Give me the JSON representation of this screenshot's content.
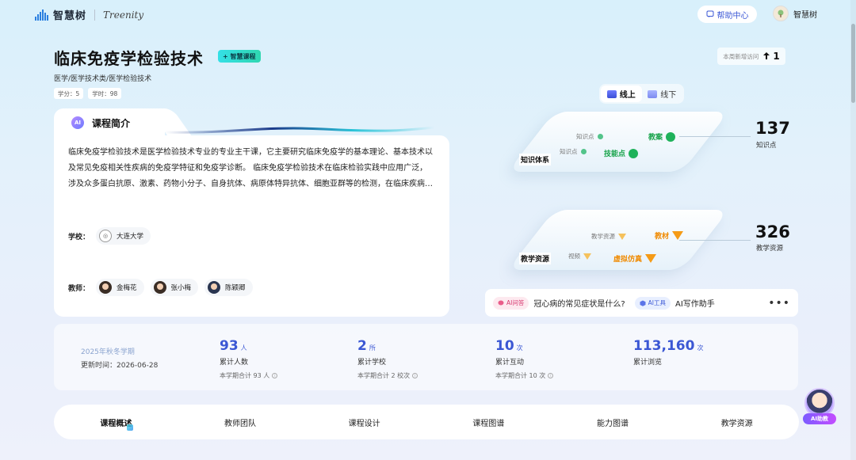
{
  "header": {
    "logo_text": "智慧树",
    "logo_secondary": "Treenity",
    "help_label": "帮助中心",
    "user_name": "智慧树"
  },
  "course": {
    "title": "临床免疫学检验技术",
    "badge": "+ 智慧课程",
    "breadcrumb": "医学/医学技术类/医学检验技术",
    "credits": "学分：5",
    "hours": "学时：98",
    "weekly_visits_label": "本周新增访问",
    "weekly_visits_value": "1"
  },
  "intro": {
    "tab_label": "课程简介",
    "ai_glyph": "AI",
    "text": "临床免疫学检验技术是医学检验技术专业的专业主干课，它主要研究临床免疫学的基本理论、基本技术以及常见免疫相关性疾病的免疫学特征和免疫学诊断。 临床免疫学检验技术在临床检验实践中应用广泛，涉及众多蛋白抗原、激素、药物小分子、自身抗体、病原体特异抗体、细胞亚群等的检测，在临床疾病的诊断、疗效评价和预后判断中具有重要作用。",
    "school_label": "学校：",
    "school_name": "大连大学",
    "teacher_label": "教师：",
    "teachers": [
      "金梅花",
      "张小梅",
      "陈颖卿"
    ]
  },
  "mode_toggle": {
    "online": "线上",
    "offline": "线下",
    "selected": "online"
  },
  "knowledge_graph": {
    "platform_label": "知识体系",
    "nodes": [
      "知识点",
      "知识点",
      "教案",
      "技能点"
    ],
    "count": "137",
    "count_label": "知识点"
  },
  "resources": {
    "platform_label": "教学资源",
    "nodes": [
      "教学资源",
      "视频",
      "教材",
      "虚拟仿真"
    ],
    "count": "326",
    "count_label": "教学资源"
  },
  "ai_bar": {
    "qa_label": "AI问答",
    "question": "冠心病的常见症状是什么?",
    "tool_label": "AI工具",
    "tool_name": "AI写作助手",
    "more": "•••"
  },
  "stats": {
    "semester": "2025年秋冬学期",
    "updated": "更新时间：2026-06-28",
    "metrics": [
      {
        "value": "93",
        "unit": "人",
        "label": "累计人数",
        "note": "本学期合计 93 人"
      },
      {
        "value": "2",
        "unit": "所",
        "label": "累计学校",
        "note": "本学期合计 2 校次"
      },
      {
        "value": "10",
        "unit": "次",
        "label": "累计互动",
        "note": "本学期合计 10 次"
      },
      {
        "value": "113,160",
        "unit": "次",
        "label": "累计浏览",
        "note": ""
      }
    ]
  },
  "tabs": [
    "课程概述",
    "教师团队",
    "课程设计",
    "课程图谱",
    "能力图谱",
    "教学资源"
  ],
  "active_tab": "课程概述",
  "ai_helper_label": "AI助教",
  "colors": {
    "accent": "#3b57d4",
    "green": "#1fb25a",
    "orange": "#f59b16"
  }
}
